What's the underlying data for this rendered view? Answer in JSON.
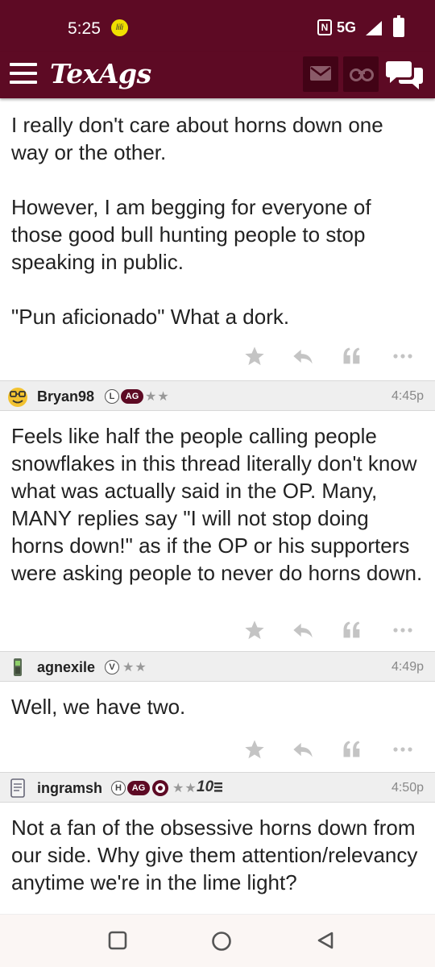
{
  "status_bar": {
    "time": "5:25",
    "network": "5G"
  },
  "app": {
    "title": "TexAgs"
  },
  "colors": {
    "brand": "#5d0a24",
    "meta_bg": "#efefef",
    "icon_gray": "#c4c4c4"
  },
  "icons": [
    "menu-icon",
    "mail-icon",
    "binoculars-icon",
    "chat-icon",
    "star-icon",
    "reply-icon",
    "quote-icon",
    "more-icon"
  ],
  "posts": [
    {
      "body": [
        "I really don't care about horns down one way or the other.",
        "However, I am begging for everyone of those good bull hunting people to stop speaking in public.",
        "\"Pun aficionado\" What a dork."
      ]
    },
    {
      "username": "Bryan98",
      "badges": [
        "L",
        "AG"
      ],
      "stars": "★★",
      "time": "4:45p",
      "body": [
        "Feels like half the people calling people snowflakes in this thread literally don't know what was actually said in the OP. Many, MANY replies say \"I will not stop doing horns down!\" as if the OP or his supporters were asking people to never do horns down."
      ]
    },
    {
      "username": "agnexile",
      "badges": [
        "V"
      ],
      "stars": "★★",
      "time": "4:49p",
      "body": [
        "Well, we have two."
      ]
    },
    {
      "username": "ingramsh",
      "badges": [
        "H",
        "AG"
      ],
      "stars": "★★",
      "extra": "10",
      "time": "4:50p",
      "body": [
        "Not a fan of the obsessive horns down from our side. Why give them attention/relevancy anytime we're in the lime light?"
      ]
    }
  ]
}
